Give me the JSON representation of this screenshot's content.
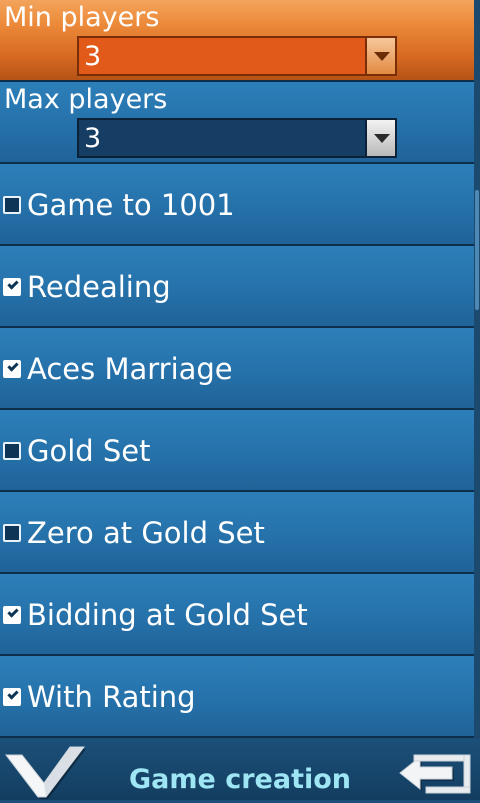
{
  "settings": {
    "min_players": {
      "label": "Min players",
      "value": "3"
    },
    "max_players": {
      "label": "Max players",
      "value": "3"
    },
    "options": [
      {
        "label": "Game to 1001",
        "checked": false
      },
      {
        "label": "Redealing",
        "checked": true
      },
      {
        "label": "Aces Marriage",
        "checked": true
      },
      {
        "label": "Gold Set",
        "checked": false
      },
      {
        "label": "Zero at Gold Set",
        "checked": false
      },
      {
        "label": "Bidding at Gold Set",
        "checked": true
      },
      {
        "label": "With Rating",
        "checked": true
      }
    ]
  },
  "bottom_bar": {
    "title": "Game creation",
    "confirm_icon": "checkmark-icon",
    "back_icon": "back-arrow-icon"
  },
  "colors": {
    "selected_row": "#ec8a3a",
    "row": "#2774ad",
    "title_text": "#9fe6f5"
  }
}
